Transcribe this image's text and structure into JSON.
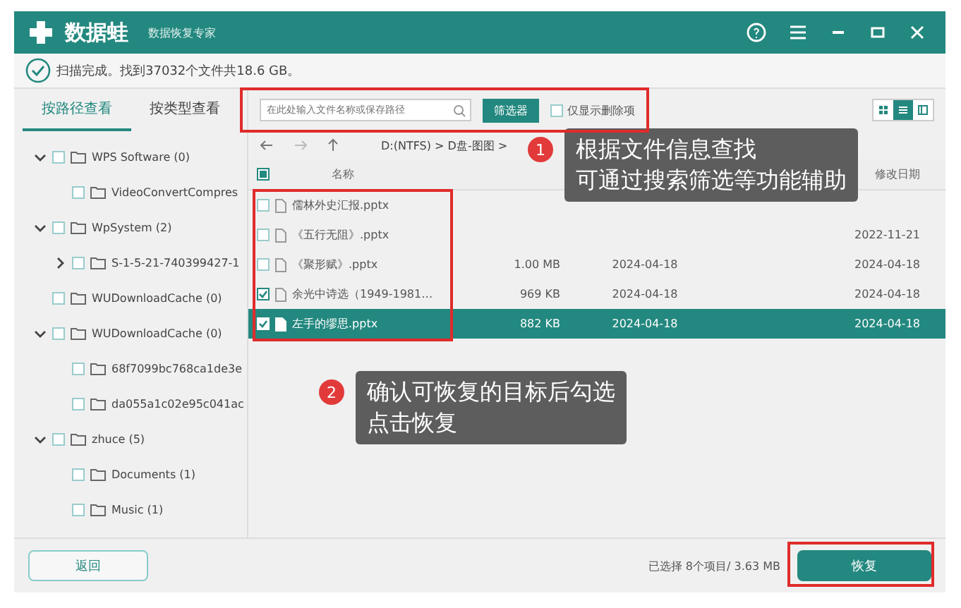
{
  "window": {
    "app_name": "数据蛙",
    "subtitle": "数据恢复专家"
  },
  "status": "扫描完成。找到37032个文件共18.6 GB。",
  "sidebar": {
    "tabs": [
      {
        "label": "按路径查看",
        "selected": true
      },
      {
        "label": "按类型查看",
        "selected": false
      }
    ],
    "tree": [
      {
        "label": "WPS Software (0)",
        "checked": false,
        "expanded": true,
        "children": [
          {
            "label": "VideoConvertCompres",
            "checked": false
          }
        ]
      },
      {
        "label": "WpSystem (2)",
        "checked": false,
        "expanded": true,
        "children": [
          {
            "label": "S-1-5-21-740399427-1",
            "checked": false,
            "expanded": false
          }
        ]
      },
      {
        "label": "WUDownloadCache (0)",
        "checked": false
      },
      {
        "label": "WUDownloadCache (0)",
        "checked": false,
        "expanded": true,
        "children": [
          {
            "label": "68f7099bc768ca1de3e",
            "checked": false
          },
          {
            "label": "da055a1c02e95c041ac",
            "checked": false
          }
        ]
      },
      {
        "label": "zhuce (5)",
        "checked": false,
        "expanded": true,
        "children": [
          {
            "label": "Documents (1)",
            "checked": false
          },
          {
            "label": "Music (1)",
            "checked": false
          }
        ]
      }
    ]
  },
  "toolbar": {
    "search": {
      "placeholder": "在此处输入文件名称或保存路径"
    },
    "filter_button": "筛选器",
    "deleted_only": {
      "label": "仅显示删除项",
      "checked": false
    },
    "views": [
      {
        "kind": "grid",
        "selected": false
      },
      {
        "kind": "list",
        "selected": true
      },
      {
        "kind": "detail",
        "selected": false
      }
    ]
  },
  "breadcrumb": "D:(NTFS) > D盘-图图 >",
  "table": {
    "header_partial": true,
    "columns": [
      "名称",
      "",
      "",
      "修改日期"
    ],
    "rows": [
      {
        "name": "儒林外史汇报.pptx",
        "size": "",
        "created": "",
        "modified": "",
        "checked": false,
        "selected": false
      },
      {
        "name": "《五行无阻》.pptx",
        "size": "",
        "created": "",
        "modified": "2022-11-21",
        "checked": false,
        "selected": false
      },
      {
        "name": "《聚形赋》.pptx",
        "size": "1.00 MB",
        "created": "2024-04-18",
        "modified": "2024-04-18",
        "checked": false,
        "selected": false
      },
      {
        "name": "余光中诗选（1949-1981…",
        "size": "969 KB",
        "created": "2024-04-18",
        "modified": "2024-04-18",
        "checked": true,
        "selected": false
      },
      {
        "name": "左手的缪思.pptx",
        "size": "882 KB",
        "created": "2024-04-18",
        "modified": "2024-04-18",
        "checked": true,
        "selected": true
      }
    ]
  },
  "callouts": [
    {
      "number": "1",
      "lines": [
        "根据文件信息查找",
        "可通过搜索筛选等功能辅助"
      ]
    },
    {
      "number": "2",
      "lines": [
        "确认可恢复的目标后勾选",
        "点击恢复"
      ]
    }
  ],
  "footer": {
    "back_button": "返回",
    "selection_summary": "已选择 8个项目/ 3.63 MB",
    "recover_button": "恢复"
  }
}
